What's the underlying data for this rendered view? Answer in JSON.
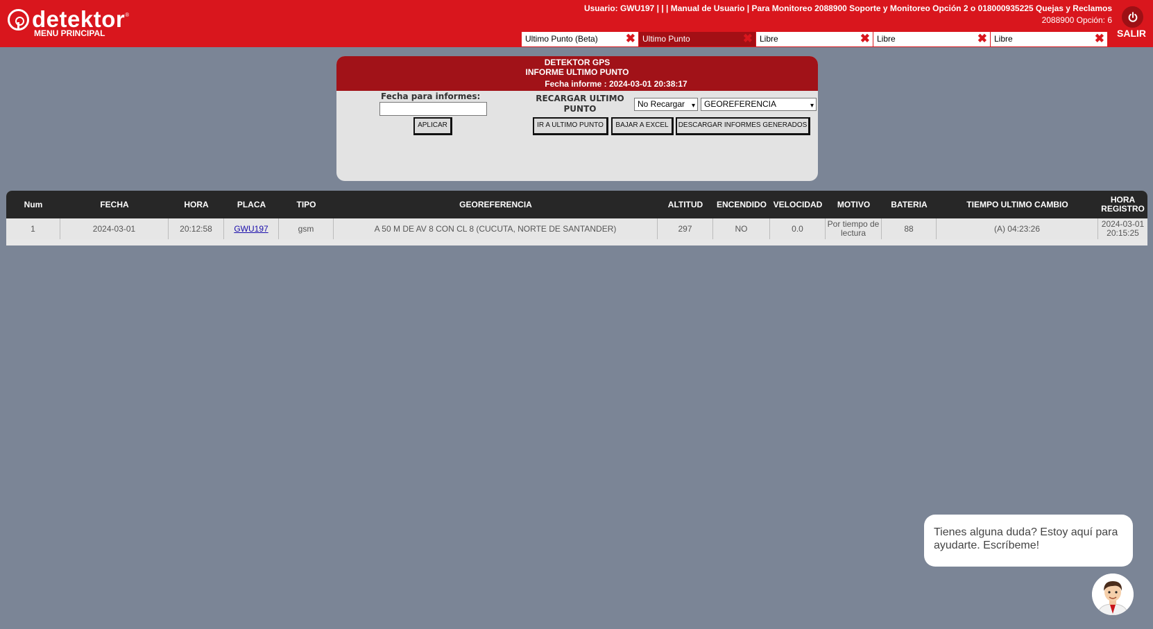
{
  "header": {
    "logo_text": "detektor",
    "logo_reg": "®",
    "menu_label": "MENU PRINCIPAL",
    "user_line_1": "Usuario: GWU197 | | | Manual de Usuario | Para Monitoreo 2088900 Soporte y Monitoreo Opción 2 o 018000935225 Quejas y Reclamos",
    "user_line_2": "2088900 Opción: 6",
    "exit_label": "SALIR",
    "tabs": [
      {
        "label": "Ultimo Punto (Beta)",
        "close": "✖",
        "active": false
      },
      {
        "label": "Ultimo Punto",
        "close": "✖",
        "active": true
      },
      {
        "label": "Libre",
        "close": "✖",
        "active": false
      },
      {
        "label": "Libre",
        "close": "✖",
        "active": false
      },
      {
        "label": "Libre",
        "close": "✖",
        "active": false
      }
    ]
  },
  "panel": {
    "title_1": "DETEKTOR GPS",
    "title_2": "INFORME ULTIMO PUNTO",
    "report_date": "Fecha informe : 2024-03-01 20:38:17",
    "date_label": "Fecha para informes:",
    "date_value": "",
    "apply_button": "APLICAR",
    "reload_label": "RECARGAR ULTIMO PUNTO",
    "reload_select": "No Recargar",
    "geo_select": "GEOREFERENCIA",
    "goto_button": "IR A ULTIMO PUNTO",
    "excel_button": "BAJAR A EXCEL",
    "download_button": "DESCARGAR INFORMES GENERADOS"
  },
  "table": {
    "columns": [
      "Num",
      "FECHA",
      "HORA",
      "PLACA",
      "TIPO",
      "GEOREFERENCIA",
      "ALTITUD",
      "ENCENDIDO",
      "VELOCIDAD",
      "MOTIVO",
      "BATERIA",
      "TIEMPO ULTIMO CAMBIO",
      "HORA REGISTRO"
    ],
    "rows": [
      [
        "1",
        "2024-03-01",
        "20:12:58",
        "GWU197",
        "gsm",
        "A 50 M DE AV 8 CON CL 8 (CUCUTA, NORTE DE SANTANDER)",
        "297",
        "NO",
        "0.0",
        "Por tiempo de lectura",
        "88",
        "(A) 04:23:26",
        "2024-03-01 20:15:25"
      ]
    ]
  },
  "chat": {
    "message": "Tienes alguna duda? Estoy aquí para ayudarte. Escríbeme!"
  },
  "colors": {
    "brand_red": "#d9161d",
    "dark_red": "#a11218",
    "background": "#7b8596",
    "table_header": "#272727"
  },
  "icons": [
    "power-icon",
    "close-icon",
    "chevron-down-icon",
    "assistant-avatar-icon"
  ]
}
